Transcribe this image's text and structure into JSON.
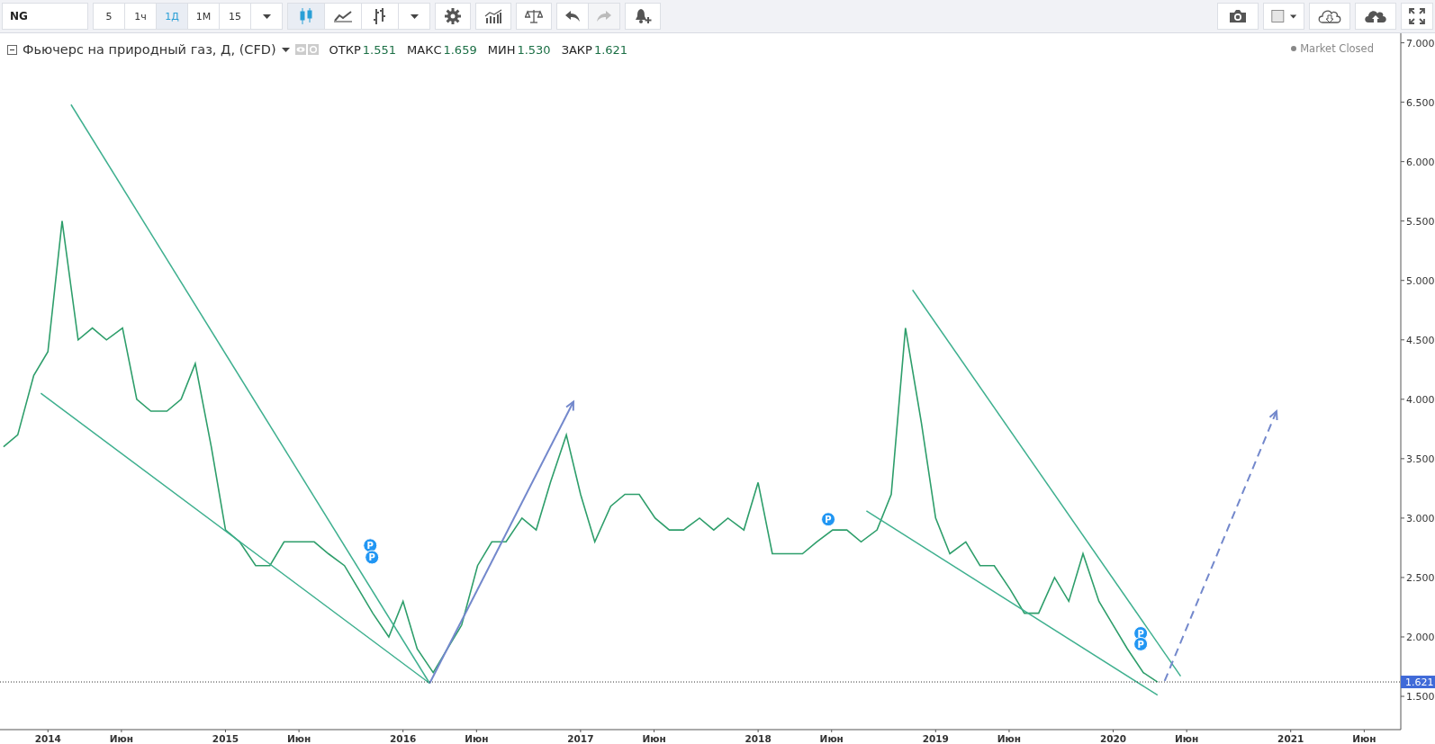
{
  "toolbar": {
    "symbol": "NG",
    "intervals": [
      {
        "label": "5",
        "selected": false
      },
      {
        "label": "1ч",
        "selected": false
      },
      {
        "label": "1Д",
        "selected": true
      },
      {
        "label": "1М",
        "selected": false
      },
      {
        "label": "15",
        "selected": false
      }
    ],
    "chart_types": [
      {
        "kind": "candles",
        "selected": true
      },
      {
        "kind": "line",
        "selected": false
      },
      {
        "kind": "bars",
        "selected": false
      }
    ],
    "tools": [
      {
        "kind": "settings",
        "disabled": false
      },
      {
        "kind": "indicators",
        "disabled": false
      },
      {
        "kind": "compare",
        "disabled": false
      },
      {
        "kind": "undo",
        "disabled": false
      },
      {
        "kind": "redo",
        "disabled": true
      },
      {
        "kind": "alert",
        "disabled": false
      }
    ],
    "right_tools": [
      {
        "kind": "camera"
      },
      {
        "kind": "color"
      },
      {
        "kind": "download"
      },
      {
        "kind": "upload"
      },
      {
        "kind": "fullscreen"
      }
    ]
  },
  "legend": {
    "title": "Фьючерс на природный газ, Д, (CFD)",
    "values": [
      {
        "label": "ОТКР",
        "value": "1.551"
      },
      {
        "label": "МАКС",
        "value": "1.659"
      },
      {
        "label": "МИН",
        "value": "1.530"
      },
      {
        "label": "ЗАКР",
        "value": "1.621"
      }
    ],
    "status": "Market Closed"
  },
  "chart_data": {
    "type": "line",
    "xlim": [
      2013.73,
      2021.62
    ],
    "ylim": [
      1.22,
      7.08
    ],
    "x": [
      2013.75,
      2013.83,
      2013.92,
      2014.0,
      2014.08,
      2014.17,
      2014.25,
      2014.33,
      2014.42,
      2014.5,
      2014.58,
      2014.67,
      2014.75,
      2014.83,
      2014.92,
      2015.0,
      2015.08,
      2015.17,
      2015.25,
      2015.33,
      2015.42,
      2015.5,
      2015.58,
      2015.67,
      2015.75,
      2015.83,
      2015.92,
      2016.0,
      2016.08,
      2016.17,
      2016.25,
      2016.33,
      2016.42,
      2016.5,
      2016.58,
      2016.67,
      2016.75,
      2016.83,
      2016.92,
      2017.0,
      2017.08,
      2017.17,
      2017.25,
      2017.33,
      2017.42,
      2017.5,
      2017.58,
      2017.67,
      2017.75,
      2017.83,
      2017.92,
      2018.0,
      2018.08,
      2018.17,
      2018.25,
      2018.33,
      2018.42,
      2018.5,
      2018.58,
      2018.67,
      2018.75,
      2018.83,
      2018.92,
      2019.0,
      2019.08,
      2019.17,
      2019.25,
      2019.33,
      2019.42,
      2019.5,
      2019.58,
      2019.67,
      2019.75,
      2019.83,
      2019.92,
      2020.0,
      2020.08,
      2020.17,
      2020.25
    ],
    "series": [
      {
        "color": "#2e9e6b",
        "values": [
          3.6,
          3.7,
          4.2,
          4.4,
          5.5,
          4.5,
          4.6,
          4.5,
          4.6,
          4.0,
          3.9,
          3.9,
          4.0,
          4.3,
          3.6,
          2.9,
          2.8,
          2.6,
          2.6,
          2.8,
          2.8,
          2.8,
          2.7,
          2.6,
          2.4,
          2.2,
          2.0,
          2.3,
          1.9,
          1.7,
          1.9,
          2.1,
          2.6,
          2.8,
          2.8,
          3.0,
          2.9,
          3.3,
          3.7,
          3.2,
          2.8,
          3.1,
          3.2,
          3.2,
          3.0,
          2.9,
          2.9,
          3.0,
          2.9,
          3.0,
          2.9,
          3.3,
          2.7,
          2.7,
          2.7,
          2.8,
          2.9,
          2.9,
          2.8,
          2.9,
          3.2,
          4.6,
          3.8,
          3.0,
          2.7,
          2.8,
          2.6,
          2.6,
          2.4,
          2.2,
          2.2,
          2.5,
          2.3,
          2.7,
          2.3,
          2.1,
          1.9,
          1.7,
          1.62
        ]
      }
    ],
    "xticks": [
      {
        "value": 2014,
        "label": "2014"
      },
      {
        "value": 2014.414,
        "label": "Июн"
      },
      {
        "value": 2015,
        "label": "2015"
      },
      {
        "value": 2015.414,
        "label": "Июн"
      },
      {
        "value": 2016,
        "label": "2016"
      },
      {
        "value": 2016.414,
        "label": "Июн"
      },
      {
        "value": 2017,
        "label": "2017"
      },
      {
        "value": 2017.414,
        "label": "Июн"
      },
      {
        "value": 2018,
        "label": "2018"
      },
      {
        "value": 2018.414,
        "label": "Июн"
      },
      {
        "value": 2019,
        "label": "2019"
      },
      {
        "value": 2019.414,
        "label": "Июн"
      },
      {
        "value": 2020,
        "label": "2020"
      },
      {
        "value": 2020.414,
        "label": "Июн"
      },
      {
        "value": 2021,
        "label": "2021"
      },
      {
        "value": 2021.414,
        "label": "Июн"
      }
    ],
    "yticks": [
      {
        "value": 1.5,
        "label": "1.500"
      },
      {
        "value": 2.0,
        "label": "2.000"
      },
      {
        "value": 2.5,
        "label": "2.500"
      },
      {
        "value": 3.0,
        "label": "3.000"
      },
      {
        "value": 3.5,
        "label": "3.500"
      },
      {
        "value": 4.0,
        "label": "4.000"
      },
      {
        "value": 4.5,
        "label": "4.500"
      },
      {
        "value": 5.0,
        "label": "5.000"
      },
      {
        "value": 5.5,
        "label": "5.500"
      },
      {
        "value": 6.0,
        "label": "6.000"
      },
      {
        "value": 6.5,
        "label": "6.500"
      },
      {
        "value": 7.0,
        "label": "7.000"
      }
    ]
  },
  "markers": [
    {
      "text": "P"
    },
    {
      "text": "P"
    },
    {
      "text": "P"
    },
    {
      "text": "P"
    },
    {
      "text": "P"
    }
  ],
  "last_price": "1.621"
}
